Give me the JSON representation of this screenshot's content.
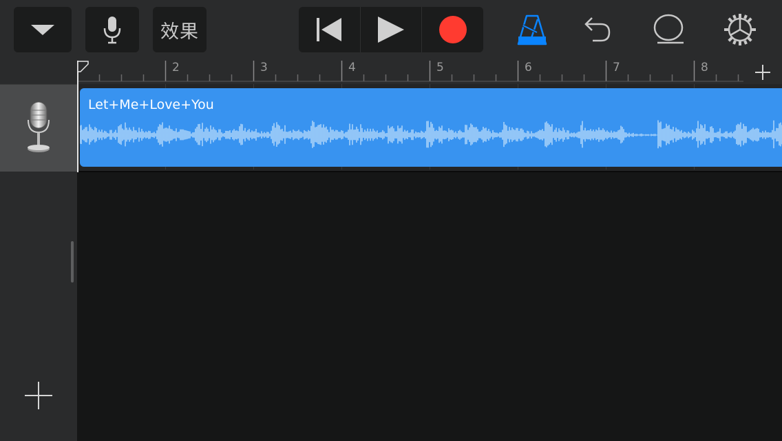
{
  "toolbar": {
    "fx_label": "效果"
  },
  "ruler": {
    "bars": [
      "2",
      "3",
      "4",
      "5",
      "6",
      "7",
      "8"
    ]
  },
  "track": {
    "icon": "microphone-icon",
    "region_name": "Let+Me+Love+You"
  },
  "colors": {
    "accent": "#0a84ff",
    "record": "#ff3b30",
    "region": "#3893f0",
    "waveform": "#a9d2f9"
  }
}
